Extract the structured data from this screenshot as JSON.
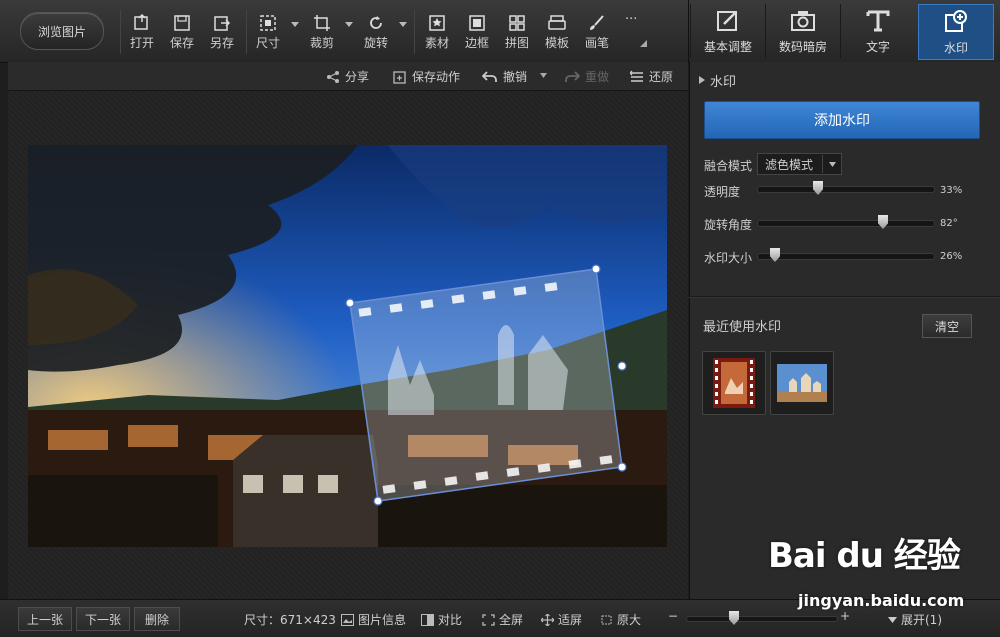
{
  "toolbar": {
    "browse_label": "浏览图片",
    "tools": [
      {
        "id": "open",
        "label": "打开",
        "icon": "open-icon"
      },
      {
        "id": "save",
        "label": "保存",
        "icon": "save-icon"
      },
      {
        "id": "saveas",
        "label": "另存",
        "icon": "save-as-icon"
      },
      {
        "id": "size",
        "label": "尺寸",
        "icon": "resize-icon"
      },
      {
        "id": "crop",
        "label": "裁剪",
        "icon": "crop-icon"
      },
      {
        "id": "rotate",
        "label": "旋转",
        "icon": "rotate-icon"
      },
      {
        "id": "material",
        "label": "素材",
        "icon": "material-icon"
      },
      {
        "id": "border",
        "label": "边框",
        "icon": "border-icon"
      },
      {
        "id": "collage",
        "label": "拼图",
        "icon": "collage-icon"
      },
      {
        "id": "template",
        "label": "模板",
        "icon": "template-icon"
      },
      {
        "id": "brush",
        "label": "画笔",
        "icon": "brush-icon"
      }
    ],
    "more_label": "···",
    "tabs": [
      {
        "label": "基本调整",
        "icon": "basic-adjust-icon"
      },
      {
        "label": "数码暗房",
        "icon": "camera-icon"
      },
      {
        "label": "文字",
        "icon": "text-icon"
      },
      {
        "label": "水印",
        "icon": "watermark-icon",
        "active": true
      }
    ]
  },
  "actions": {
    "share": "分享",
    "save_action": "保存动作",
    "undo": "撤销",
    "redo": "重做",
    "restore": "还原"
  },
  "panel": {
    "title": "水印",
    "add_button": "添加水印",
    "blend_label": "融合模式",
    "blend_value": "滤色模式",
    "sliders": [
      {
        "label": "透明度",
        "value": "33%",
        "level": 0.33
      },
      {
        "label": "旋转角度",
        "value": "82°",
        "level": 0.72
      },
      {
        "label": "水印大小",
        "value": "26%",
        "level": 0.07
      }
    ],
    "recent_title": "最近使用水印",
    "clear_label": "清空"
  },
  "bottom": {
    "prev": "上一张",
    "next": "下一张",
    "delete": "删除",
    "size_label": "尺寸：671×423",
    "info": "图片信息",
    "compare": "对比",
    "fullscreen": "全屏",
    "fit": "适屏",
    "original": "原大",
    "zoom_minus": "−",
    "zoom_plus": "+",
    "expand": "展开(1)"
  },
  "watermark_overlay": {
    "baidu": "Bai du 经验",
    "url": "jingyan.baidu.com"
  },
  "colors": {
    "accent": "#2f74c8",
    "toolbar_bg": "#2e2e2e",
    "panel_bg": "#2a2a2a"
  }
}
